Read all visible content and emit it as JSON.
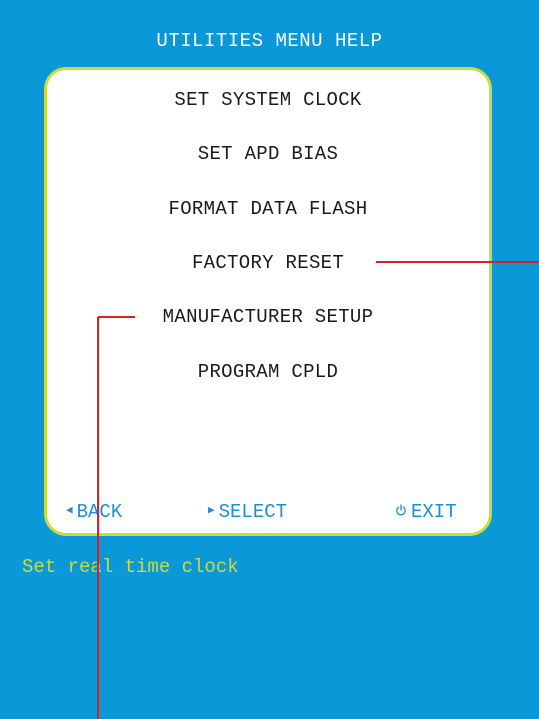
{
  "screen": {
    "title": "UTILITIES MENU HELP",
    "menu_items": [
      {
        "label": "SET SYSTEM CLOCK"
      },
      {
        "label": "SET APD BIAS"
      },
      {
        "label": "FORMAT DATA FLASH"
      },
      {
        "label": "FACTORY RESET"
      },
      {
        "label": "MANUFACTURER SETUP"
      },
      {
        "label": "PROGRAM CPLD"
      }
    ],
    "footer": {
      "back_label": "BACK",
      "select_label": "SELECT",
      "exit_label": "EXIT"
    },
    "status_text": "Set real time clock"
  },
  "colors": {
    "screen_bg": "#0b98d8",
    "panel_border": "#c9dc3a",
    "footer_text": "#1d8fd3",
    "status_text": "#c9dc3a",
    "callout_line": "#e02020"
  },
  "icons": {
    "back": "left-triangle-icon",
    "select": "right-triangle-icon",
    "exit": "power-icon"
  }
}
